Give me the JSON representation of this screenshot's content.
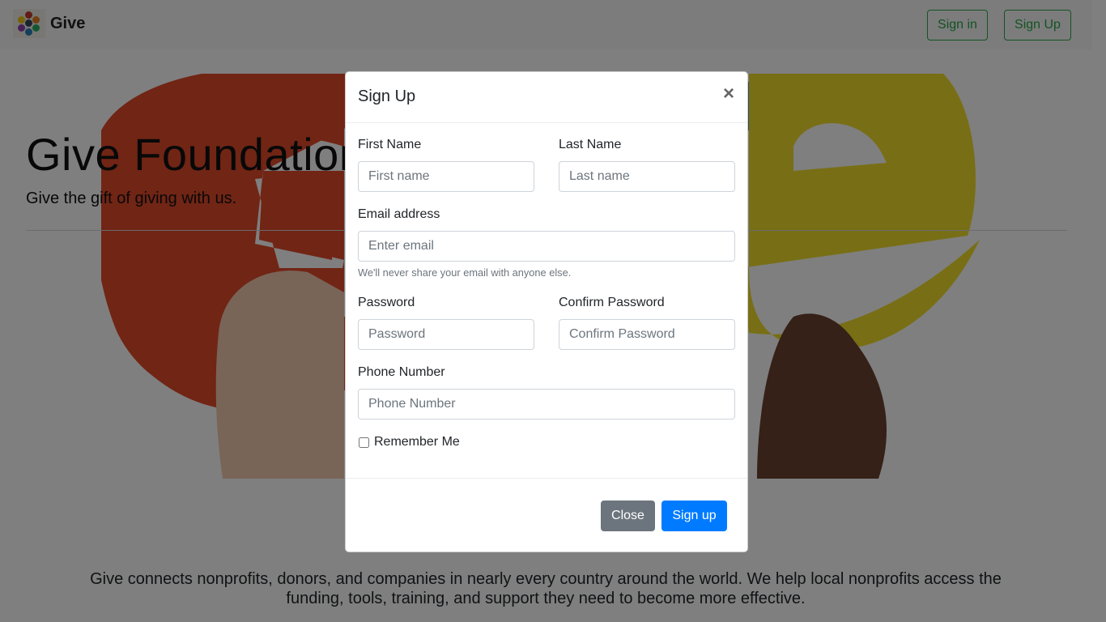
{
  "navbar": {
    "brand": "Give",
    "signin_label": "Sign in",
    "signup_label": "Sign Up"
  },
  "hero": {
    "title": "Give Foundation",
    "subtitle": "Give the gift of giving with us."
  },
  "about_text": "Give connects nonprofits, donors, and companies in nearly every country around the world. We help local nonprofits access the funding, tools, training, and support they need to become more effective.",
  "modal": {
    "title": "Sign Up",
    "close_symbol": "×",
    "fields": {
      "first_name": {
        "label": "First Name",
        "placeholder": "First name"
      },
      "last_name": {
        "label": "Last Name",
        "placeholder": "Last name"
      },
      "email": {
        "label": "Email address",
        "placeholder": "Enter email",
        "help": "We'll never share your email with anyone else."
      },
      "password": {
        "label": "Password",
        "placeholder": "Password"
      },
      "confirm_password": {
        "label": "Confirm Password",
        "placeholder": "Confirm Password"
      },
      "phone": {
        "label": "Phone Number",
        "placeholder": "Phone Number"
      }
    },
    "remember_label": "Remember Me",
    "close_label": "Close",
    "submit_label": "Sign up"
  },
  "colors": {
    "primary": "#007bff",
    "secondary": "#6c757d",
    "success": "#28a745",
    "letter_g": "#e24a2b",
    "letter_e": "#f1dd2a",
    "letter_i": "#5b8fc7"
  }
}
